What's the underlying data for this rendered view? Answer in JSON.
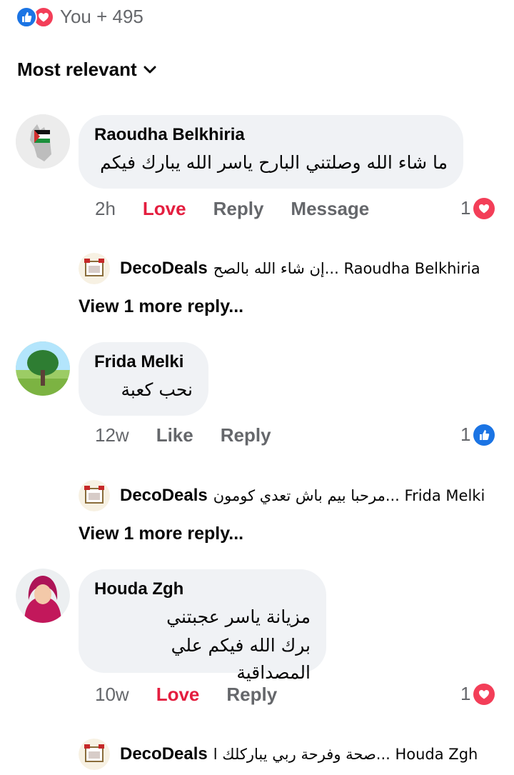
{
  "post_reactions": {
    "icons": [
      "like-icon",
      "love-icon"
    ],
    "summary": "You + 495"
  },
  "sort": {
    "label": "Most relevant"
  },
  "colors": {
    "love": "#e41e3f",
    "like_blue": "#1b74e4",
    "bubble": "#f0f2f5",
    "secondary_text": "#65676b"
  },
  "comments": [
    {
      "author": "Raoudha Belkhiria",
      "text": [
        "ما شاء الله وصلتني البارح ياسر الله يبارك فيكم"
      ],
      "time": "2h",
      "reaction_action": "Love",
      "reply_label": "Reply",
      "extra_action": "Message",
      "reaction_count": "1",
      "reaction_type": "love",
      "reply": {
        "author": "DecoDeals",
        "preview": "إن شاء الله بالصح... Raoudha Belkhiria"
      },
      "view_more": "View 1 more reply..."
    },
    {
      "author": "Frida Melki",
      "text": [
        "نحب كعبة"
      ],
      "time": "12w",
      "reaction_action": "Like",
      "reply_label": "Reply",
      "reaction_count": "1",
      "reaction_type": "like",
      "reply": {
        "author": "DecoDeals",
        "preview": "مرحبا بيم باش تعدي كومون... Frida Melki"
      },
      "view_more": "View 1 more reply..."
    },
    {
      "author": "Houda Zgh",
      "text": [
        "مزيانة ياسر عجبتني",
        "برك الله فيكم علي المصداقية"
      ],
      "time": "10w",
      "reaction_action": "Love",
      "reply_label": "Reply",
      "reaction_count": "1",
      "reaction_type": "love",
      "reply": {
        "author": "DecoDeals",
        "preview": "صحة وفرحة ربي يباركلك ا... Houda Zgh"
      }
    }
  ]
}
